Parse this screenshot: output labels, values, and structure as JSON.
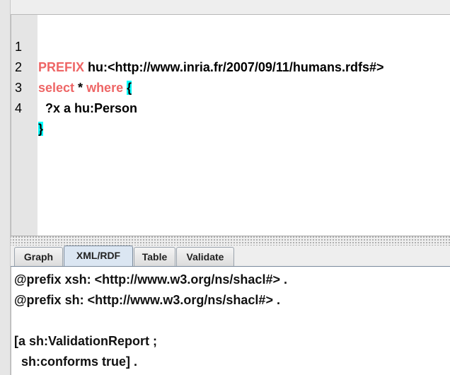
{
  "editor": {
    "lines": [
      {
        "number": "1",
        "keyword": "PREFIX",
        "rest": " hu:<http://www.inria.fr/2007/09/11/humans.rdfs#>"
      },
      {
        "number": "2",
        "keyword1": "select",
        "middle": " * ",
        "keyword2": "where",
        "space": " ",
        "brace": "{"
      },
      {
        "number": "3",
        "text": "  ?x a hu:Person"
      },
      {
        "number": "4",
        "brace": "}"
      }
    ]
  },
  "tabs": [
    {
      "label": "Graph"
    },
    {
      "label": "XML/RDF",
      "active": true
    },
    {
      "label": "Table"
    },
    {
      "label": "Validate"
    }
  ],
  "output": {
    "lines": [
      "@prefix xsh: <http://www.w3.org/ns/shacl#> .",
      "@prefix sh: <http://www.w3.org/ns/shacl#> .",
      "",
      "[a sh:ValidationReport ;",
      "  sh:conforms true] ."
    ]
  },
  "colors": {
    "keyword": "#ee6666",
    "brace_highlight": "#00ffff",
    "active_tab": "#dbe6f2"
  }
}
